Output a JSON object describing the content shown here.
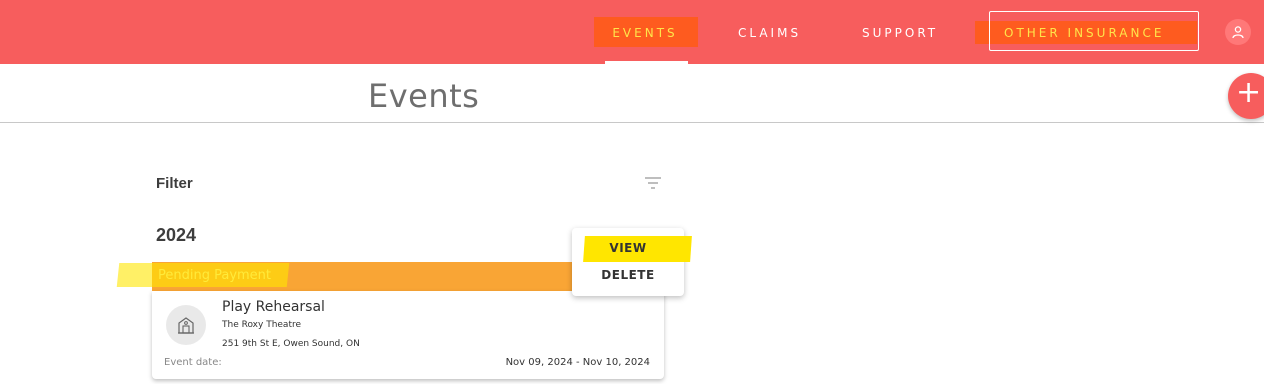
{
  "nav": {
    "items": [
      {
        "label": "EVENTS",
        "active": true
      },
      {
        "label": "CLAIMS"
      },
      {
        "label": "SUPPORT"
      },
      {
        "label": "OTHER INSURANCE"
      }
    ],
    "user_icon": "user-icon"
  },
  "header": {
    "title": "Events",
    "add_icon": "plus-icon"
  },
  "filter": {
    "label": "Filter",
    "icon": "filter-icon"
  },
  "year": "2024",
  "event_card": {
    "status": "Pending Payment",
    "name": "Play Rehearsal",
    "venue": "The Roxy Theatre",
    "address": "251 9th St E, Owen Sound, ON",
    "date_label": "Event date:",
    "date_range": "Nov 09, 2024 - Nov 10, 2024",
    "venue_icon": "venue-building-icon"
  },
  "context_menu": {
    "items": [
      "VIEW",
      "DELETE"
    ]
  },
  "colors": {
    "brand": "#f75d5d",
    "status_pending": "#f9a535",
    "highlight_yellow": "#ffe600",
    "highlight_orange": "#ff5a14"
  }
}
